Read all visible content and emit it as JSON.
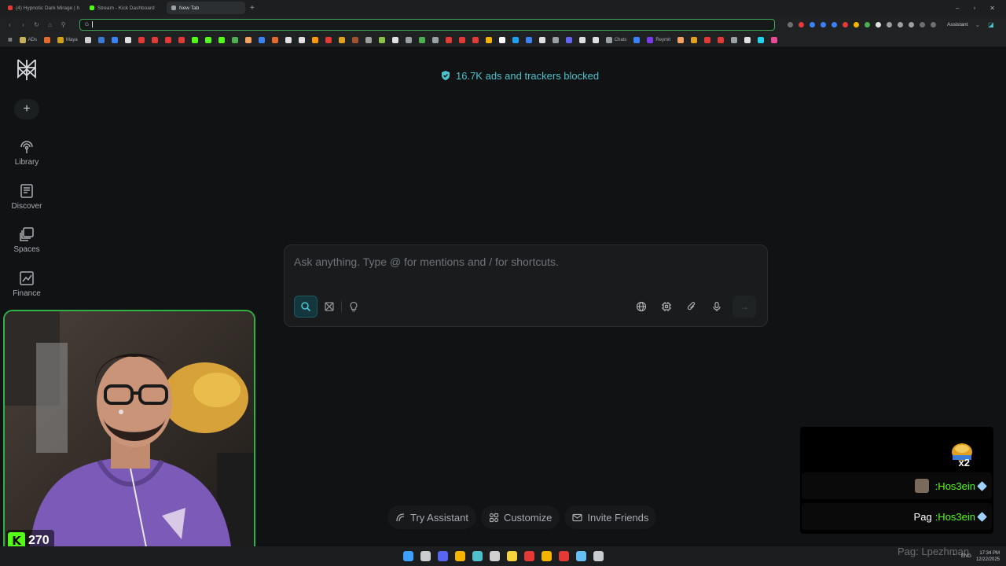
{
  "browser": {
    "tabs": [
      {
        "title": "(4) Hypnotic Dark Mirage | h",
        "favicon_color": "#e53935"
      },
      {
        "title": "Stream - Kick Dashboard",
        "favicon_color": "#53fc18"
      },
      {
        "title": "New Tab",
        "favicon_color": "#9aa0a4"
      }
    ],
    "active_tab_index": 2,
    "address_bar": {
      "prefix": "G",
      "value": ""
    },
    "assistant_label": "Assistant",
    "bookmarks": [
      {
        "label": "ADs",
        "color": "#c8b05a"
      },
      {
        "label": "",
        "color": "#e66a2c"
      },
      {
        "label": "Maya",
        "color": "#d4a017"
      },
      {
        "label": "",
        "color": "#cfcfcf"
      },
      {
        "label": "",
        "color": "#3a7bd5"
      },
      {
        "label": "",
        "color": "#3b82f6"
      },
      {
        "label": "",
        "color": "#e0e0e0"
      },
      {
        "label": "",
        "color": "#e53935"
      },
      {
        "label": "",
        "color": "#e53935"
      },
      {
        "label": "",
        "color": "#e53935"
      },
      {
        "label": "",
        "color": "#e53935"
      },
      {
        "label": "",
        "color": "#53fc18"
      },
      {
        "label": "",
        "color": "#53fc18"
      },
      {
        "label": "",
        "color": "#53fc18"
      },
      {
        "label": "",
        "color": "#4caf50"
      },
      {
        "label": "",
        "color": "#f4a261"
      },
      {
        "label": "",
        "color": "#3b82f6"
      },
      {
        "label": "",
        "color": "#e66a2c"
      },
      {
        "label": "",
        "color": "#e0e0e0"
      },
      {
        "label": "",
        "color": "#e0e0e0"
      },
      {
        "label": "",
        "color": "#ff9800"
      },
      {
        "label": "",
        "color": "#e53935"
      },
      {
        "label": "",
        "color": "#e0a020"
      },
      {
        "label": "",
        "color": "#a0522d"
      },
      {
        "label": "",
        "color": "#9e9e9e"
      },
      {
        "label": "",
        "color": "#8bc34a"
      },
      {
        "label": "",
        "color": "#e0e0e0"
      },
      {
        "label": "",
        "color": "#9aa0a4"
      },
      {
        "label": "",
        "color": "#4caf50"
      },
      {
        "label": "",
        "color": "#9aa0a4"
      },
      {
        "label": "",
        "color": "#e53935"
      },
      {
        "label": "",
        "color": "#e53935"
      },
      {
        "label": "",
        "color": "#e53935"
      },
      {
        "label": "",
        "color": "#f4b400"
      },
      {
        "label": "",
        "color": "#ffffff"
      },
      {
        "label": "",
        "color": "#1da1f2"
      },
      {
        "label": "",
        "color": "#3b82f6"
      },
      {
        "label": "",
        "color": "#e0e0e0"
      },
      {
        "label": "",
        "color": "#9aa0a4"
      },
      {
        "label": "",
        "color": "#6366f1"
      },
      {
        "label": "",
        "color": "#e0e0e0"
      },
      {
        "label": "",
        "color": "#e0e0e0"
      },
      {
        "label": "Chats",
        "color": "#9aa0a4"
      },
      {
        "label": "",
        "color": "#3b82f6"
      },
      {
        "label": "Reymit",
        "color": "#7c3aed"
      },
      {
        "label": "",
        "color": "#f4a261"
      },
      {
        "label": "",
        "color": "#e0a020"
      },
      {
        "label": "",
        "color": "#e53935"
      },
      {
        "label": "",
        "color": "#e53935"
      },
      {
        "label": "",
        "color": "#9aa0a4"
      },
      {
        "label": "",
        "color": "#e0e0e0"
      },
      {
        "label": "",
        "color": "#22d3ee"
      },
      {
        "label": "",
        "color": "#ec4899"
      }
    ]
  },
  "sidebar": {
    "new_thread_label": "+",
    "items": [
      {
        "label": "Library",
        "icon": "library-icon"
      },
      {
        "label": "Discover",
        "icon": "discover-icon"
      },
      {
        "label": "Spaces",
        "icon": "spaces-icon"
      },
      {
        "label": "Finance",
        "icon": "finance-icon"
      }
    ]
  },
  "main": {
    "blocked_banner": "16.7K ads and trackers blocked",
    "ask": {
      "placeholder": "Ask anything. Type @ for mentions and / for shortcuts.",
      "modes": [
        "search-icon",
        "research-icon",
        "labs-icon"
      ],
      "active_mode": "search-icon",
      "tools": [
        "globe-icon",
        "cpu-chip-icon",
        "paperclip-icon",
        "microphone-icon"
      ],
      "submit_icon": "arrow-right-icon"
    },
    "bottom_links": [
      {
        "label": "Try Assistant",
        "icon": "assistant-icon"
      },
      {
        "label": "Customize",
        "icon": "customize-icon"
      },
      {
        "label": "Invite Friends",
        "icon": "mail-icon"
      }
    ]
  },
  "stream": {
    "viewer_count": "270",
    "kick_logo_letter": "K",
    "chat": [
      {
        "prefix": "",
        "user": ":Hos3ein",
        "has_avatar": true
      },
      {
        "prefix": "Pag",
        "user": ":Hos3ein",
        "has_avatar": false
      }
    ],
    "gift_multiplier": "x2",
    "watermark": "Pag: Lpezhman"
  },
  "colors": {
    "accent_teal": "#4ec2cc",
    "kick_green": "#53fc18",
    "webcam_border": "#2fb146"
  },
  "taskbar": {
    "icons": [
      {
        "name": "windows-start-icon",
        "color": "#3ba0ff"
      },
      {
        "name": "task-view-icon",
        "color": "#c9cdd0"
      },
      {
        "name": "discord-icon",
        "color": "#5865f2"
      },
      {
        "name": "app-icon",
        "color": "#f4b400"
      },
      {
        "name": "perplexity-browser-icon",
        "color": "#4ec2cc"
      },
      {
        "name": "obs-icon",
        "color": "#d0d0d0"
      },
      {
        "name": "sticky-notes-icon",
        "color": "#f6d33c"
      },
      {
        "name": "media-player-icon",
        "color": "#e53935"
      },
      {
        "name": "file-explorer-icon",
        "color": "#f4b400"
      },
      {
        "name": "app-icon",
        "color": "#e53935"
      },
      {
        "name": "steam-icon",
        "color": "#66c0f4"
      },
      {
        "name": "terminal-icon",
        "color": "#c9cdd0"
      }
    ],
    "language": "ENG",
    "time": "17:34 PM",
    "date": "12/22/2025"
  }
}
